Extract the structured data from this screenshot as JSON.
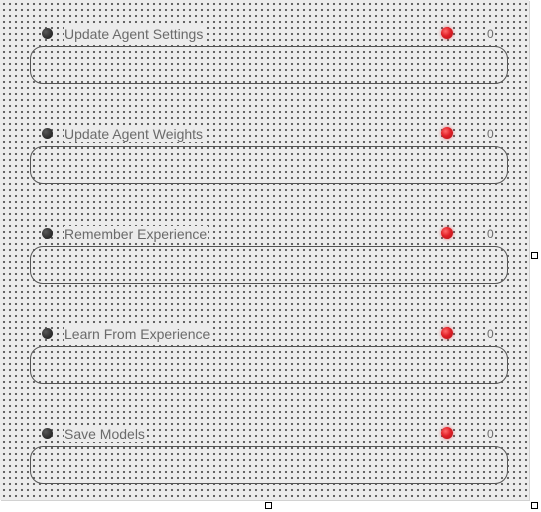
{
  "rows": [
    {
      "label": "Update Agent Settings",
      "count": "0"
    },
    {
      "label": "Update Agent Weights",
      "count": "0"
    },
    {
      "label": "Remember Experience",
      "count": "0"
    },
    {
      "label": "Learn From Experience",
      "count": "0"
    },
    {
      "label": "Save Models",
      "count": "0"
    }
  ],
  "colors": {
    "canvas_background": "#ececec",
    "grid_dot": "#555555",
    "indicator": "#2e2e2e",
    "led": "#e01f26",
    "label_text": "#6a6a6a",
    "box_border": "#555555"
  },
  "icons": {
    "indicator": "dark-circle-indicator-icon",
    "led": "red-led-icon",
    "handle": "resize-handle-icon"
  }
}
